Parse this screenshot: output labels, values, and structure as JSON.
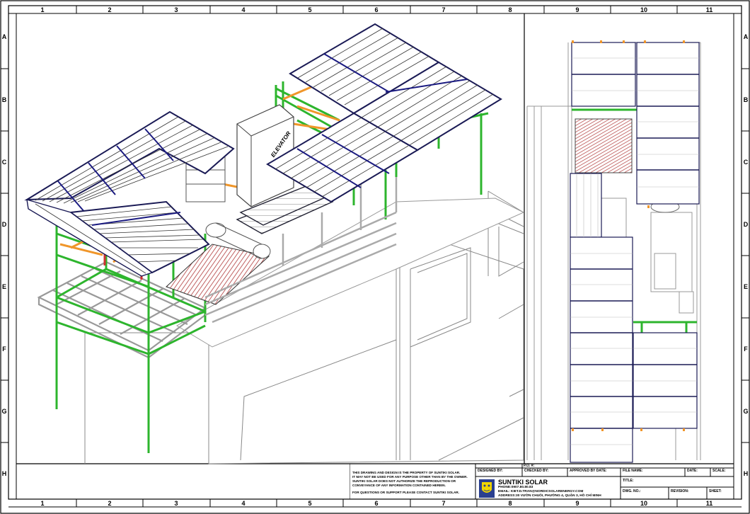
{
  "border": {
    "columns": [
      "1",
      "2",
      "3",
      "4",
      "5",
      "6",
      "7",
      "8",
      "9",
      "10",
      "11"
    ],
    "rows": [
      "A",
      "B",
      "C",
      "D",
      "E",
      "F",
      "G",
      "H"
    ]
  },
  "drawing": {
    "elevator_label": "ELEVATOR"
  },
  "title_block": {
    "notice_lines": [
      "THIS DRAWING AND DESIGN IS THE PROPERTY OF SUNTIKI SOLAR.",
      "IT MAY NOT BE USED FOR ANY PURPOSE OTHER THAN BY THE OWNER.",
      "SUNTIKI SOLAR DOES NOT AUTHORIZE THE REPRODUCTION OR",
      "CONVEYANCE OF ANY INFORMATION CONTAINED HEREIN."
    ],
    "support_line": "FOR QUESTIONS OR SUPPORT PLEASE CONTACT SUNTIKI SOLAR.",
    "designed_by_label": "DESIGNED BY:",
    "checked_by_label": "CHECKED BY:",
    "approved_by_label": "APPROVED BY DATE:",
    "file_name_label": "FILE NAME:",
    "date_label": "DATE:",
    "scale_label": "SCALE:",
    "po_label": "P.O. #:",
    "title_label": "TITLE:",
    "dwg_no_label": "DWG. NO.:",
    "revision_label": "REVISION:",
    "sheet_label": "SHEET:",
    "company": "SUNTIKI SOLAR",
    "phone": "PHONE:0907.80.80.83",
    "email": "EMAIL: KIET.D.TRAN@NORDICSOLARENERGY.COM",
    "address": "ADDRESS:30 VƯỜN CHUỐI, PHƯỜNG 4, QUẬN 3, HỒ CHÍ MINH"
  }
}
